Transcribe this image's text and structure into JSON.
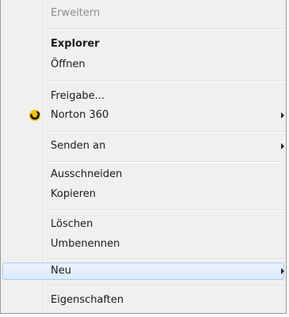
{
  "context_menu": {
    "items": [
      {
        "label": "Erweitern",
        "disabled": true
      },
      {
        "label": "Explorer",
        "bold": true
      },
      {
        "label": "Öffnen"
      },
      {
        "label": "Freigabe..."
      },
      {
        "label": "Norton 360",
        "icon": "norton-icon",
        "submenu": true
      },
      {
        "label": "Senden an",
        "submenu": true
      },
      {
        "label": "Ausschneiden"
      },
      {
        "label": "Kopieren"
      },
      {
        "label": "Löschen"
      },
      {
        "label": "Umbenennen"
      },
      {
        "label": "Neu",
        "submenu": true,
        "highlighted": true
      },
      {
        "label": "Eigenschaften"
      }
    ]
  },
  "colors": {
    "menu_background": "#f0f0f0",
    "highlight_border": "#a8cbf1",
    "highlight_fill": "#dcebfc",
    "disabled_text": "#8d8d8d",
    "norton_yellow": "#f5c400"
  }
}
